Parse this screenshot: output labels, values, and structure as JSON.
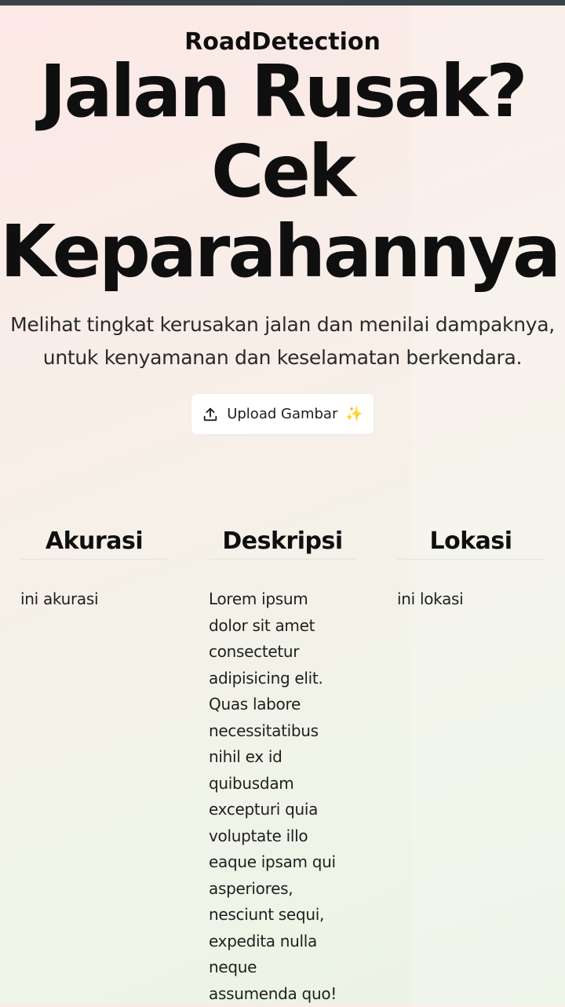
{
  "app": {
    "brand": "RoadDetection"
  },
  "hero": {
    "title_lines": [
      "Jalan Rusak?",
      "Cek",
      "Keparahannya!"
    ],
    "subtitle_lines": [
      "Melihat tingkat kerusakan jalan dan menilai dampaknya,",
      "untuk kenyamanan dan keselamatan berkendara."
    ]
  },
  "upload": {
    "label": "Upload Gambar",
    "sparkle": "✨",
    "icon": "upload-icon"
  },
  "columns": [
    {
      "title": "Akurasi",
      "body_lines": [
        "ini akurasi"
      ]
    },
    {
      "title": "Deskripsi",
      "body_lines": [
        "Lorem ipsum",
        "dolor sit amet",
        "consectetur",
        "adipisicing elit.",
        "Quas labore",
        "necessitatibus",
        "nihil ex id",
        "quibusdam",
        "excepturi quia",
        "voluptate illo",
        "eaque ipsam qui",
        "asperiores,",
        "nesciunt sequi,",
        "expedita nulla",
        "neque",
        "assumenda quo!"
      ]
    },
    {
      "title": "Lokasi",
      "body_lines": [
        "ini lokasi"
      ]
    }
  ],
  "colors": {
    "top_bar": "#3a4346",
    "text": "#0f0f0f",
    "sparkle": "#f3c22b"
  }
}
